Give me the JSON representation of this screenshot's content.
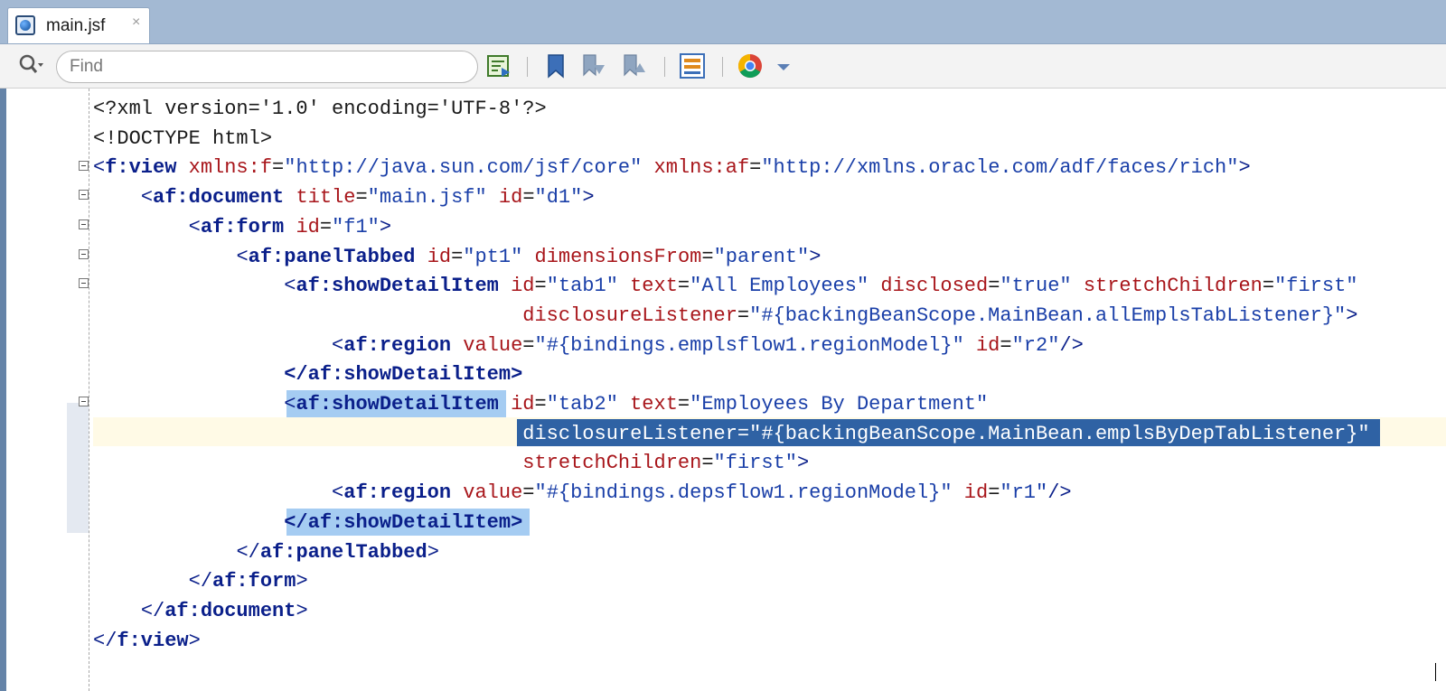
{
  "tab": {
    "title": "main.jsf",
    "close_glyph": "×"
  },
  "toolbar": {
    "find_placeholder": "Find",
    "icons": [
      "search-icon",
      "toggle-highlight-icon",
      "bookmark-icon",
      "next-bookmark-icon",
      "previous-bookmark-icon",
      "structure-icon",
      "chrome-browser-icon",
      "dropdown-arrow-icon"
    ]
  },
  "colors": {
    "tag": "#0a1f8a",
    "attribute": "#a8161b",
    "value": "#1a3fa8",
    "selection": "#2f62a4",
    "match_highlight": "#a5ccf2",
    "current_line": "#fffae6",
    "tab_strip": "#a3b9d3"
  },
  "code": {
    "l1": "<?xml version='1.0' encoding='UTF-8'?>",
    "l2": "<!DOCTYPE html>",
    "fview": "f:view",
    "xmlns_f": "xmlns:f",
    "xmlns_f_val": "\"http://java.sun.com/jsf/core\"",
    "xmlns_af": "xmlns:af",
    "xmlns_af_val": "\"http://xmlns.oracle.com/adf/faces/rich\"",
    "afdocument": "af:document",
    "title_attr": "title",
    "title_val": "\"main.jsf\"",
    "id": "id",
    "d1": "\"d1\"",
    "afform": "af:form",
    "f1": "\"f1\"",
    "afpaneltabbed": "af:panelTabbed",
    "pt1": "\"pt1\"",
    "dimensionsfrom": "dimensionsFrom",
    "parent": "\"parent\"",
    "afshowdetailitem": "af:showDetailItem",
    "tab1": "\"tab1\"",
    "text": "text",
    "allemp": "\"All Employees\"",
    "disclosed": "disclosed",
    "true": "\"true\"",
    "stretchchildren": "stretchChildren",
    "first": "\"first\"",
    "disclosurelistener": "disclosureListener",
    "listener1": "\"#{backingBeanScope.MainBean.allEmplsTabListener}\"",
    "afregion": "af:region",
    "value": "value",
    "region1": "\"#{bindings.emplsflow1.regionModel}\"",
    "r2": "\"r2\"",
    "tab2": "\"tab2\"",
    "empbydep": "\"Employees By Department\"",
    "listener2_line": "disclosureListener=\"#{backingBeanScope.MainBean.emplsByDepTabListener}\"",
    "region2": "\"#{bindings.depsflow1.regionModel}\"",
    "r1": "\"r1\"",
    "close_sdi": "</af:showDetailItem>",
    "fview_close": "f:view"
  }
}
